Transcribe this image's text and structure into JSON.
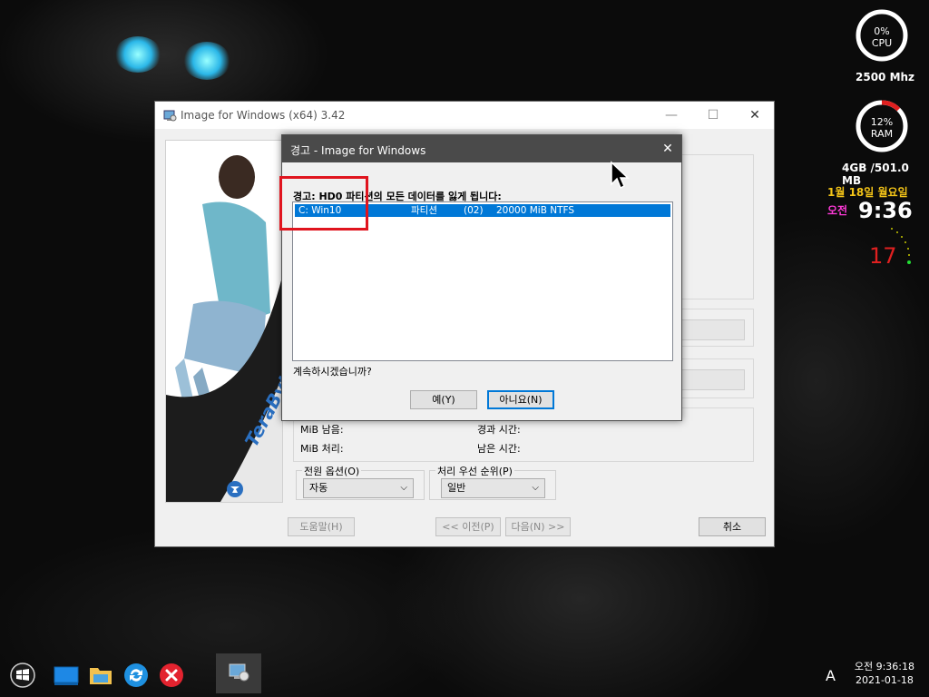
{
  "desktop": {
    "widgets": {
      "cpu": {
        "percent": "0%",
        "label": "CPU",
        "freq": "2500 Mhz",
        "fill": 0.0
      },
      "ram": {
        "percent": "12%",
        "label": "RAM",
        "usage": "4GB /501.0 MB",
        "fill": 0.12
      },
      "date": "1월 18일 월요일",
      "ampm": "오전",
      "time": "9:36",
      "seconds": "17"
    }
  },
  "window": {
    "title": "Image for Windows (x64) 3.42",
    "minimize": "—",
    "maximize": "☐",
    "close": "✕",
    "labels": {
      "mib_left": "MiB 남음:",
      "mib_processed": "MiB 처리:",
      "elapsed": "경과 시간:",
      "remaining": "남은 시간:"
    },
    "power_options": {
      "title": "전원 옵션(O)",
      "value": "자동"
    },
    "priority": {
      "title": "처리 우선 순위(P)",
      "value": "일반"
    },
    "buttons": {
      "help": "도움말(H)",
      "prev": "<< 이전(P)",
      "next": "다음(N) >>",
      "cancel": "취소"
    },
    "brand": "TeraByte"
  },
  "dialog": {
    "title": "경고 - Image for Windows",
    "close": "✕",
    "warning": "경고: HD0 파티션의 모든 데이터를 잃게 됩니다:",
    "rows": [
      {
        "drive": "C: Win10",
        "type": "파티션",
        "index": "(02)",
        "size": "20000 MiB NTFS"
      }
    ],
    "question": "계속하시겠습니까?",
    "yes": "예(Y)",
    "no": "아니요(N)"
  },
  "taskbar": {
    "lang": "A",
    "clock_time": "오전 9:36:18",
    "clock_date": "2021-01-18"
  },
  "colors": {
    "accent": "#0078d7",
    "highlight_box": "#e0141e",
    "seconds": "#e02020",
    "date": "#f5c518",
    "ampm": "#ff3ad8"
  }
}
